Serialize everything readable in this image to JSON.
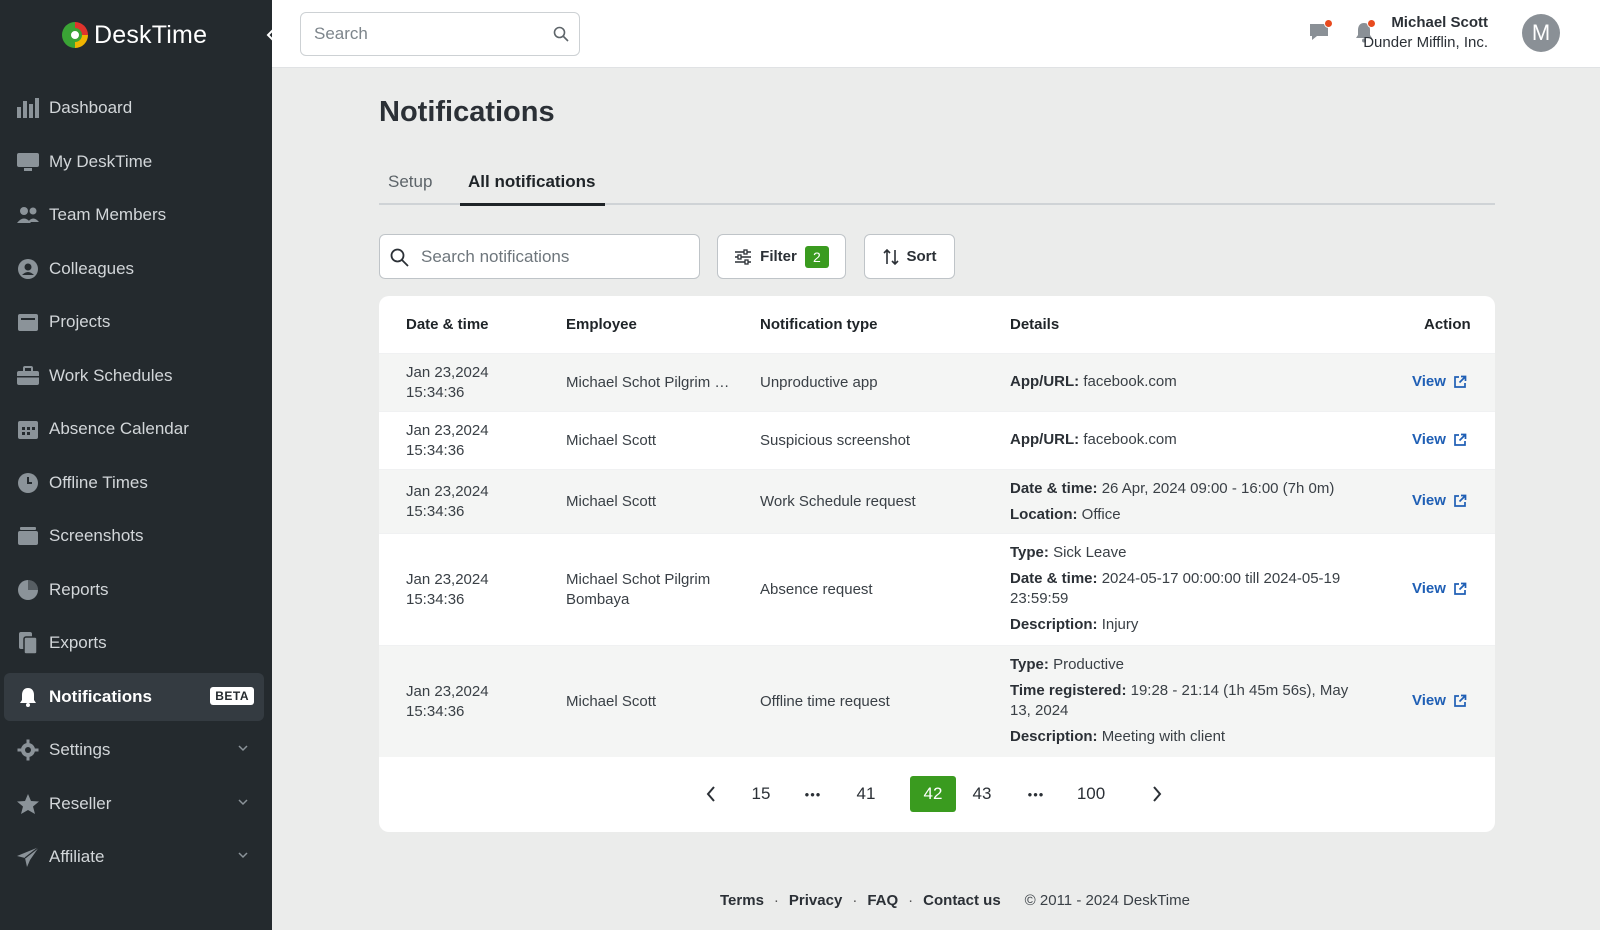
{
  "app": {
    "name": "DeskTime"
  },
  "sidebar": {
    "items": [
      {
        "label": "Dashboard",
        "icon": "bar-chart-icon"
      },
      {
        "label": "My DeskTime",
        "icon": "monitor-icon"
      },
      {
        "label": "Team Members",
        "icon": "team-icon"
      },
      {
        "label": "Colleagues",
        "icon": "user-circle-icon"
      },
      {
        "label": "Projects",
        "icon": "folder-icon"
      },
      {
        "label": "Work Schedules",
        "icon": "briefcase-icon"
      },
      {
        "label": "Absence Calendar",
        "icon": "calendar-icon"
      },
      {
        "label": "Offline Times",
        "icon": "clock-icon"
      },
      {
        "label": "Screenshots",
        "icon": "screenshots-icon"
      },
      {
        "label": "Reports",
        "icon": "pie-chart-icon"
      },
      {
        "label": "Exports",
        "icon": "files-icon"
      },
      {
        "label": "Notifications",
        "icon": "bell-icon",
        "badge": "BETA",
        "active": true
      },
      {
        "label": "Settings",
        "icon": "gear-icon",
        "expandable": true
      },
      {
        "label": "Reseller",
        "icon": "star-icon",
        "expandable": true
      },
      {
        "label": "Affiliate",
        "icon": "send-icon",
        "expandable": true
      }
    ]
  },
  "topbar": {
    "search_placeholder": "Search",
    "user": {
      "name": "Michael Scott",
      "company": "Dunder Mifflin, Inc.",
      "initial": "M"
    }
  },
  "page": {
    "title": "Notifications",
    "tabs": [
      {
        "label": "Setup",
        "active": false
      },
      {
        "label": "All notifications",
        "active": true
      }
    ],
    "search_placeholder": "Search notifications",
    "filter_label": "Filter",
    "filter_count": "2",
    "sort_label": "Sort"
  },
  "table": {
    "columns": [
      "Date & time",
      "Employee",
      "Notification type",
      "Details",
      "Action"
    ],
    "rows": [
      {
        "date": "Jan 23,2024",
        "time": "15:34:36",
        "employee": "Michael  Schot Pilgrim Bombaya",
        "type": "Unproductive app",
        "details": [
          {
            "key": "App/URL:",
            "value": "facebook.com"
          }
        ],
        "action": "View"
      },
      {
        "date": "Jan 23,2024",
        "time": "15:34:36",
        "employee": "Michael Scott",
        "type": "Suspicious screenshot",
        "details": [
          {
            "key": "App/URL:",
            "value": "facebook.com"
          }
        ],
        "action": "View"
      },
      {
        "date": "Jan 23,2024",
        "time": "15:34:36",
        "employee": "Michael Scott",
        "type": "Work Schedule request",
        "details": [
          {
            "key": "Date & time:",
            "value": "26 Apr, 2024 09:00 - 16:00 (7h 0m)"
          },
          {
            "key": "Location:",
            "value": "Office"
          }
        ],
        "action": "View"
      },
      {
        "date": "Jan 23,2024",
        "time": "15:34:36",
        "employee": "Michael  Schot Pilgrim Bombaya",
        "type": "Absence request",
        "details": [
          {
            "key": "Type:",
            "value": "Sick Leave"
          },
          {
            "key": "Date & time:",
            "value": "2024-05-17 00:00:00 till 2024-05-19 23:59:59"
          },
          {
            "key": "Description:",
            "value": "Injury"
          }
        ],
        "action": "View"
      },
      {
        "date": "Jan 23,2024",
        "time": "15:34:36",
        "employee": "Michael Scott",
        "type": "Offline time request",
        "details": [
          {
            "key": "Type:",
            "value": "Productive"
          },
          {
            "key": "Time registered:",
            "value": "19:28 - 21:14 (1h 45m 56s), May 13, 2024"
          },
          {
            "key": "Description:",
            "value": "Meeting with client"
          }
        ],
        "action": "View"
      }
    ]
  },
  "pagination": {
    "items": [
      "15",
      "•••",
      "41",
      "42",
      "43",
      "•••",
      "100"
    ],
    "current": "42"
  },
  "footer": {
    "links": [
      "Terms",
      "Privacy",
      "FAQ",
      "Contact us"
    ],
    "separator": "·",
    "copyright": "© 2011 - 2024 DeskTime"
  },
  "colors": {
    "sidebar_bg": "#242a2e",
    "accent_green": "#3a9b1f",
    "link_blue": "#1f5fb5",
    "notification_dot": "#e84a1e"
  }
}
